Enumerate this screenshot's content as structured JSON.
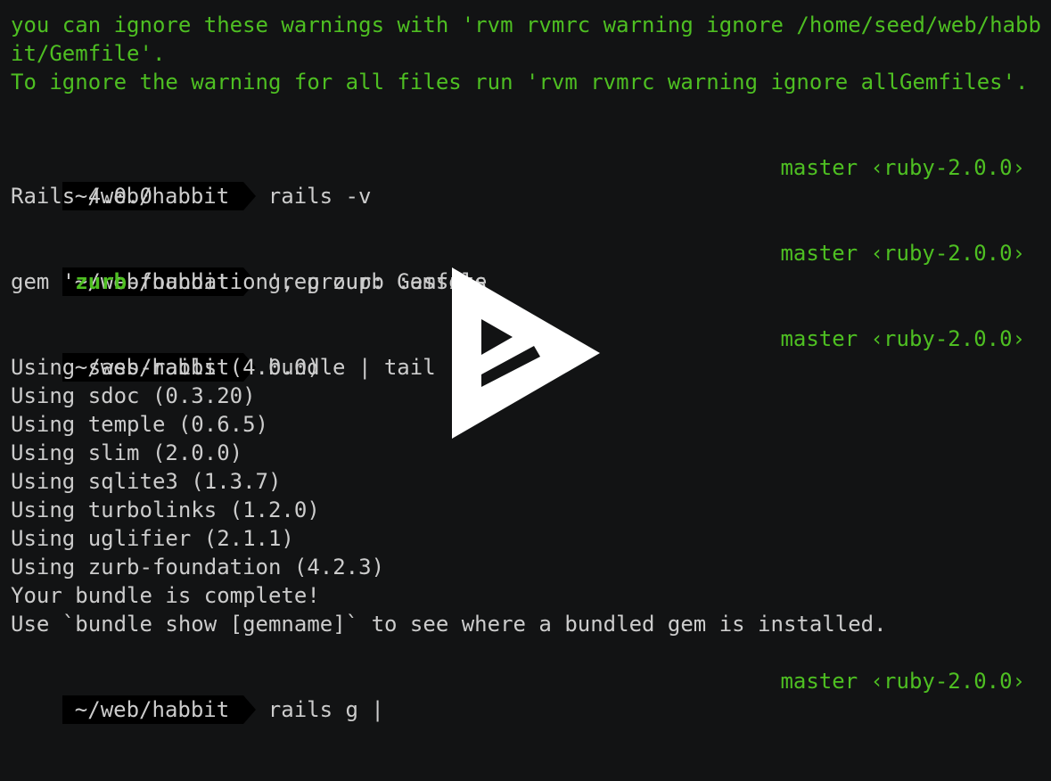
{
  "colors": {
    "background": "#121314",
    "text": "#cccccc",
    "accent": "#4ebf22",
    "prompt_bg": "#000000"
  },
  "warning": {
    "line1": "you can ignore these warnings with 'rvm rvmrc warning ignore /home/seed/web/habb",
    "line2": "it/Gemfile'.",
    "line3": "To ignore the warning for all files run 'rvm rvmrc warning ignore allGemfiles'."
  },
  "prompt": {
    "path": "~/web/habbit",
    "rprompt": "master ‹ruby-2.0.0›"
  },
  "blocks": [
    {
      "command": "rails -v",
      "output": [
        "Rails 4.0.0"
      ]
    },
    {
      "command": "grep zurb Gemfile",
      "output": {
        "pre": "gem '",
        "match": "zurb",
        "post": "-foundation', group: :assets"
      }
    },
    {
      "command": "bundle | tail",
      "output": [
        "Using sass-rails (4.0.0)",
        "Using sdoc (0.3.20)",
        "Using temple (0.6.5)",
        "Using slim (2.0.0)",
        "Using sqlite3 (1.3.7)",
        "Using turbolinks (1.2.0)",
        "Using uglifier (2.1.1)",
        "Using zurb-foundation (4.2.3)",
        "Your bundle is complete!",
        "Use `bundle show [gemname]` to see where a bundled gem is installed."
      ]
    },
    {
      "command": "rails g ",
      "cursor": "|"
    }
  ],
  "overlay": {
    "icon": "asciinema-play-icon"
  }
}
